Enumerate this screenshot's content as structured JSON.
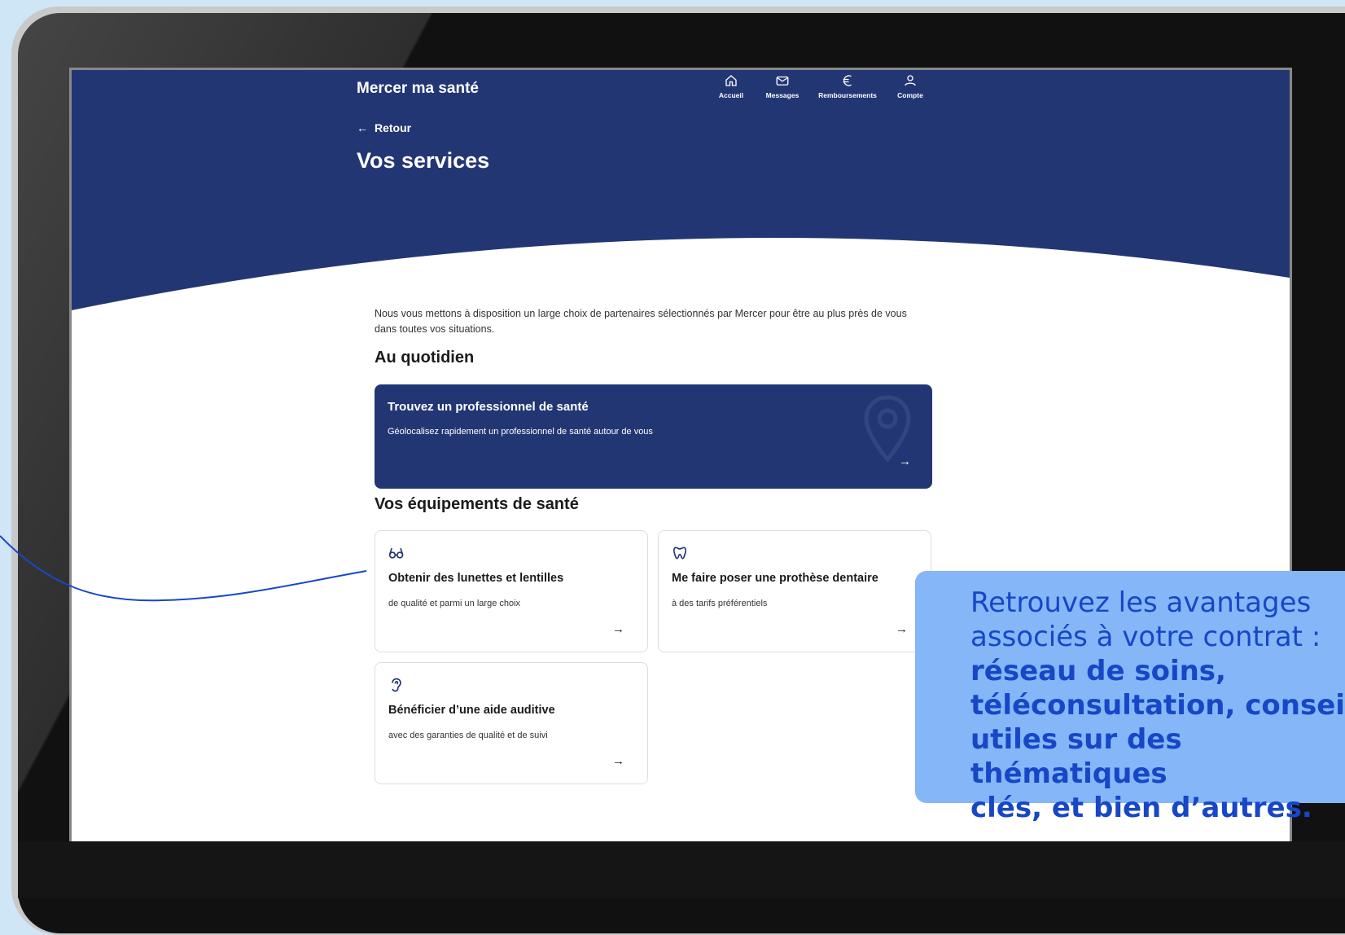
{
  "app": {
    "brand": "Mercer ma santé"
  },
  "nav": [
    {
      "label": "Accueil",
      "icon": "home-icon"
    },
    {
      "label": "Messages",
      "icon": "mail-icon"
    },
    {
      "label": "Remboursements",
      "icon": "euro-icon"
    },
    {
      "label": "Compte",
      "icon": "user-icon"
    }
  ],
  "header": {
    "back_label": "Retour",
    "title": "Vos services"
  },
  "intro": "Nous vous mettons à disposition un large choix de partenaires sélectionnés par Mercer pour être au plus près de vous dans toutes vos situations.",
  "sections": {
    "daily": {
      "title": "Au quotidien",
      "card": {
        "title": "Trouvez un professionnel de santé",
        "subtitle": "Géolocalisez rapidement un professionnel de santé autour de vous",
        "icon": "location-pin-icon"
      }
    },
    "equipment": {
      "title": "Vos équipements de santé",
      "cards": [
        {
          "title": "Obtenir des lunettes et lentilles",
          "subtitle": "de qualité et parmi un large choix",
          "icon": "glasses-icon"
        },
        {
          "title": "Me faire poser une prothèse dentaire",
          "subtitle": "à des tarifs préférentiels",
          "icon": "tooth-icon"
        },
        {
          "title": "Bénéficier d’une aide auditive",
          "subtitle": "avec des garanties de qualité et de suivi",
          "icon": "ear-icon"
        }
      ]
    }
  },
  "callout": {
    "line1": "Retrouvez les avantages",
    "line2": "associés à votre contrat :",
    "bold1": "réseau de soins,",
    "bold2": "téléconsultation, conseils",
    "bold3": "utiles sur des thématiques",
    "bold4": "clés, et bien d’autres."
  },
  "colors": {
    "primary": "#233674",
    "callout_bg": "#85b6f7",
    "callout_text": "#1747c7",
    "page_bg": "#cfe6f7"
  }
}
